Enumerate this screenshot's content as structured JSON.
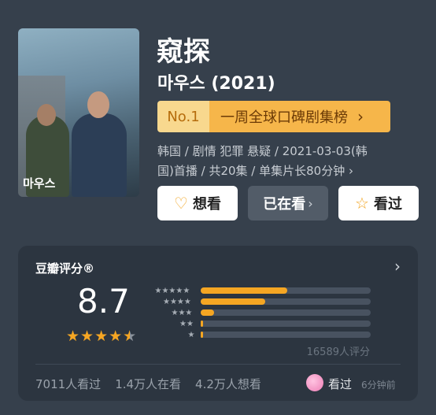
{
  "movie": {
    "title": "窥探",
    "original_title": "마우스 (2021)",
    "poster_title": "마우스"
  },
  "rank": {
    "number": "No.1",
    "list_name": "一周全球口碑剧集榜",
    "chevron": "›"
  },
  "meta": {
    "info": "韩国 / 剧情 犯罪 悬疑 / 2021-03-03(韩国)首播 / 共20集 / 单集片长80分钟",
    "chevron": "›"
  },
  "actions": {
    "want": {
      "label": "想看",
      "icon": "heart-plus-icon",
      "glyph": "♡"
    },
    "doing": {
      "label": "已在看",
      "arrow": "›"
    },
    "done": {
      "label": "看过",
      "icon": "star-outline-icon",
      "glyph": "☆"
    }
  },
  "rating": {
    "header": "豆瓣评分®",
    "header_chevron": "›",
    "score": "8.7",
    "stars_value": 4.5,
    "stars_full": "★★★★",
    "stars_half": "★",
    "distribution": [
      {
        "stars": 5,
        "label": "★★★★★",
        "fraction": 0.51
      },
      {
        "stars": 4,
        "label": "★★★★",
        "fraction": 0.38
      },
      {
        "stars": 3,
        "label": "★★★",
        "fraction": 0.08
      },
      {
        "stars": 2,
        "label": "★★",
        "fraction": 0.01
      },
      {
        "stars": 1,
        "label": "★",
        "fraction": 0.01
      }
    ],
    "count_text": "16589人评分"
  },
  "stats": {
    "seen": "7011人看过",
    "watching": "1.4万人在看",
    "want": "4.2万人想看"
  },
  "friend": {
    "action": "看过",
    "time": "6分钟前"
  },
  "colors": {
    "accent": "#f5a623",
    "background": "#36404c",
    "panel": "#2c3540"
  }
}
